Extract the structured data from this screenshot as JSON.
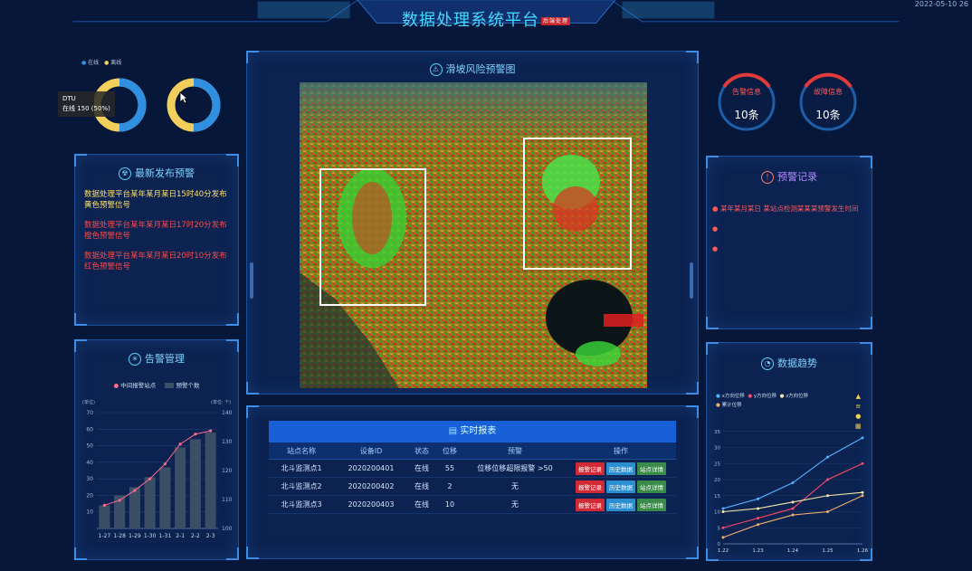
{
  "header": {
    "title": "数据处理系统平台",
    "badge": "后端处理",
    "datetime": "2022-05-10 26"
  },
  "colors": {
    "accent": "#47d8ff",
    "ring_blue": "#2f8fe0",
    "ring_yellow": "#f2cf5a",
    "alert_red": "#e03a3a",
    "warn_yellow": "#ffe06a"
  },
  "donuts": {
    "legend": [
      "在线",
      "离线"
    ],
    "tooltip_line1": "DTU",
    "tooltip_line2": "在线 150 (50%)",
    "donut1_fraction": 0.5,
    "donut2_fraction": 0.5
  },
  "latest_warnings": {
    "title": "最新发布预警",
    "icon": "radiation-icon",
    "items": [
      {
        "text": "数据处理平台某年某月某日15时40分发布黄色预警信号",
        "color": "#ffe06a"
      },
      {
        "text": "数据处理平台某年某月某日17时20分发布橙色预警信号",
        "color": "#ff4a4a"
      },
      {
        "text": "数据处理平台某年某月某日20时10分发布红色预警信号",
        "color": "#ff4a4a"
      }
    ]
  },
  "alarm_management": {
    "title": "告警管理",
    "legend": [
      "中间报警站点",
      "预警个数"
    ],
    "y_left_unit": "(单位)",
    "y_right_unit": "(单位: 个)",
    "chart_data": {
      "type": "bar",
      "categories": [
        "1-27",
        "1-28",
        "1-29",
        "1-30",
        "1-31",
        "2-1",
        "2-2",
        "2-3"
      ],
      "bar_values": [
        14,
        20,
        25,
        31,
        37,
        49,
        54,
        58
      ],
      "line_values": [
        14,
        17,
        23,
        30,
        39,
        51,
        57,
        59
      ],
      "ylim_left": [
        0,
        70
      ],
      "ylim_right": [
        100,
        140
      ],
      "yticks_left": [
        10,
        20,
        30,
        40,
        50,
        60,
        70
      ],
      "yticks_right": [
        100,
        110,
        120,
        130,
        140
      ]
    }
  },
  "map_panel": {
    "title": "滑坡风险预警图",
    "icon": "landslide-icon"
  },
  "ring_stats": [
    {
      "label": "告警信息",
      "value": "10条"
    },
    {
      "label": "故障信息",
      "value": "10条"
    }
  ],
  "warning_records": {
    "title": "预警记录",
    "items": [
      "某年某月某日 某站点检测某某某预警发生时间"
    ]
  },
  "station_table": {
    "title": "实时报表",
    "headers": [
      "站点名称",
      "设备ID",
      "状态",
      "位移",
      "预警",
      "操作"
    ],
    "rows": [
      {
        "name": "北斗监测点1",
        "id": "2020200401",
        "status": "在线",
        "disp": "55",
        "warn": "位移位移超限报警 >50"
      },
      {
        "name": "北斗监测点2",
        "id": "2020200402",
        "status": "在线",
        "disp": "2",
        "warn": "无"
      },
      {
        "name": "北斗监测点3",
        "id": "2020200403",
        "status": "在线",
        "disp": "10",
        "warn": "无"
      }
    ],
    "actions": [
      "报警记录",
      "历史数据",
      "站点详情"
    ]
  },
  "data_trend": {
    "title": "数据趋势",
    "legend": [
      "x方向位移",
      "y方向位移",
      "z方向位移",
      "累计位移"
    ],
    "chart_data": {
      "type": "line",
      "x": [
        "1.22",
        "1.23",
        "1.24",
        "1.25",
        "1.26"
      ],
      "series": [
        {
          "name": "x方向位移",
          "color": "#4fb2ff",
          "values": [
            11,
            14,
            19,
            27,
            33
          ]
        },
        {
          "name": "y方向位移",
          "color": "#ff4a6a",
          "values": [
            5,
            8,
            11,
            20,
            25
          ]
        },
        {
          "name": "z方向位移",
          "color": "#f5e8a8",
          "values": [
            10,
            11,
            13,
            15,
            16
          ]
        },
        {
          "name": "累计位移",
          "color": "#f0b070",
          "values": [
            2,
            6,
            9,
            10,
            15
          ]
        }
      ],
      "ylim": [
        0,
        40
      ],
      "yticks": [
        0,
        5,
        10,
        15,
        20,
        25,
        30,
        35
      ]
    }
  }
}
